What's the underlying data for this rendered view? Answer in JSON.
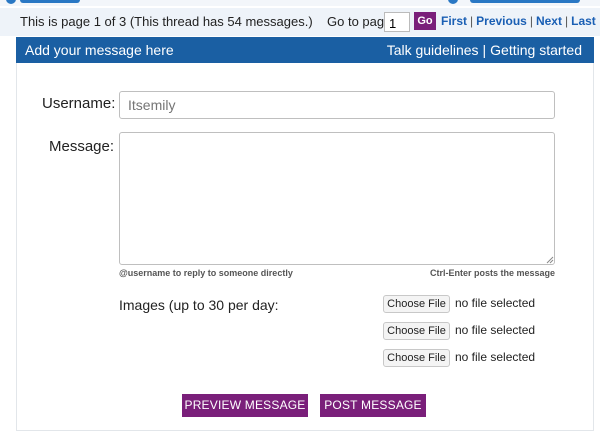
{
  "pagination": {
    "info": "This is page 1 of 3 (This thread has 54 messages.)",
    "goto_label": "Go to page",
    "page_value": "1",
    "go_label": "Go",
    "first": "First",
    "previous": "Previous",
    "next": "Next",
    "last": "Last",
    "separator": "|"
  },
  "header": {
    "title": "Add your message here",
    "talk_guidelines": "Talk guidelines",
    "separator": "|",
    "getting_started": "Getting started"
  },
  "form": {
    "username_label": "Username:",
    "username_placeholder": "Itsemily",
    "message_label": "Message:",
    "reply_hint": "@username to reply to someone directly",
    "submit_hint": "Ctrl-Enter posts the message",
    "images_label": "Images (up to 30 per day:",
    "files": [
      {
        "button": "Choose File",
        "status": "no file selected"
      },
      {
        "button": "Choose File",
        "status": "no file selected"
      },
      {
        "button": "Choose File",
        "status": "no file selected"
      }
    ],
    "preview_button": "PREVIEW MESSAGE",
    "post_button": "POST MESSAGE"
  },
  "colors": {
    "header_bg": "#1a5fa3",
    "accent_purple": "#7a1f7a",
    "link_blue": "#1a5fb4"
  }
}
